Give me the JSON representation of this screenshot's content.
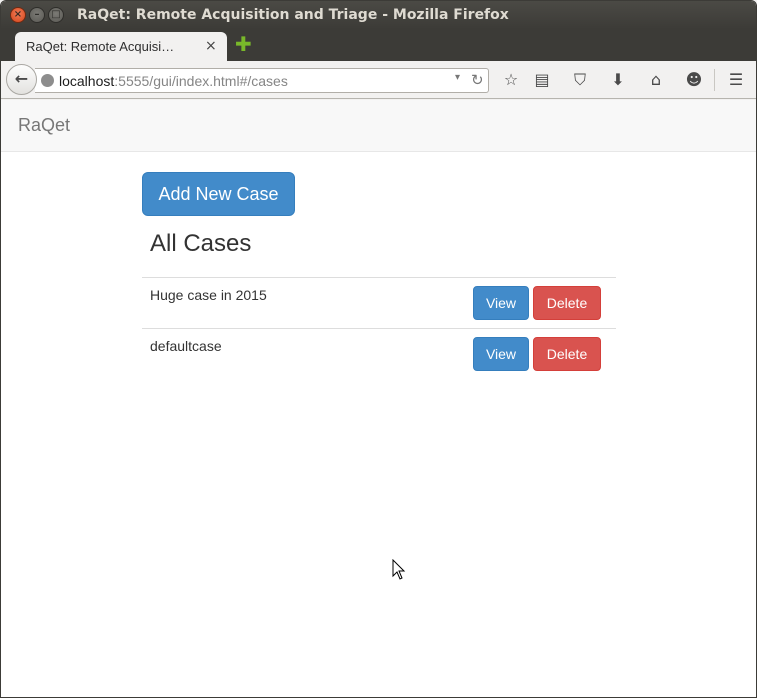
{
  "window": {
    "title": "RaQet: Remote Acquisition and Triage - Mozilla Firefox",
    "close_glyph": "×",
    "min_glyph": "–",
    "max_glyph": "□"
  },
  "tabs": [
    {
      "label": "RaQet: Remote Acquisi…",
      "close_glyph": "×"
    }
  ],
  "new_tab_glyph": "✚",
  "toolbar": {
    "back_glyph": "←",
    "url_host": "localhost",
    "url_rest": ":5555/gui/index.html#/cases",
    "url_dropdown_glyph": "▾",
    "reload_glyph": "↻",
    "icons": {
      "bookmark": "☆",
      "reader": "▤",
      "pocket": "⛉",
      "download": "⬇",
      "home": "⌂",
      "hello": "☻",
      "menu": "☰"
    }
  },
  "app": {
    "brand": "RaQet",
    "add_button": "Add New Case",
    "heading": "All Cases",
    "cases": [
      {
        "name": "Huge case in 2015",
        "view": "View",
        "delete": "Delete"
      },
      {
        "name": "defaultcase",
        "view": "View",
        "delete": "Delete"
      }
    ]
  },
  "colors": {
    "primary": "#428bca",
    "danger": "#d9534f",
    "titlebar": "#3c3b37"
  }
}
